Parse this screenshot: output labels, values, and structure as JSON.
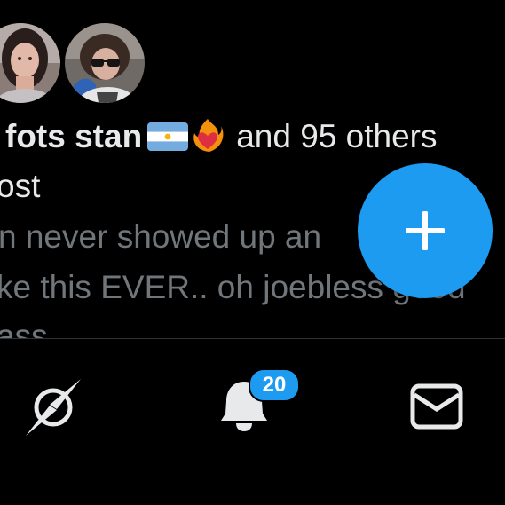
{
  "post": {
    "liked_by_name": "fots stan",
    "others_text": "and 95 others",
    "line2": "ost",
    "line3": "n never showed up an",
    "line4": "ke this EVER.. oh joebless good",
    "line5": "ass"
  },
  "nav": {
    "notifications_badge": "20"
  },
  "colors": {
    "accent": "#1d9bf0",
    "background": "#000000",
    "primary_text": "#e7e9ea",
    "secondary_text": "#71767b"
  },
  "icons": [
    "flag-argentina-icon",
    "heart-on-fire-icon",
    "compose-plus-icon",
    "explore-icon",
    "bell-icon",
    "mail-icon"
  ]
}
